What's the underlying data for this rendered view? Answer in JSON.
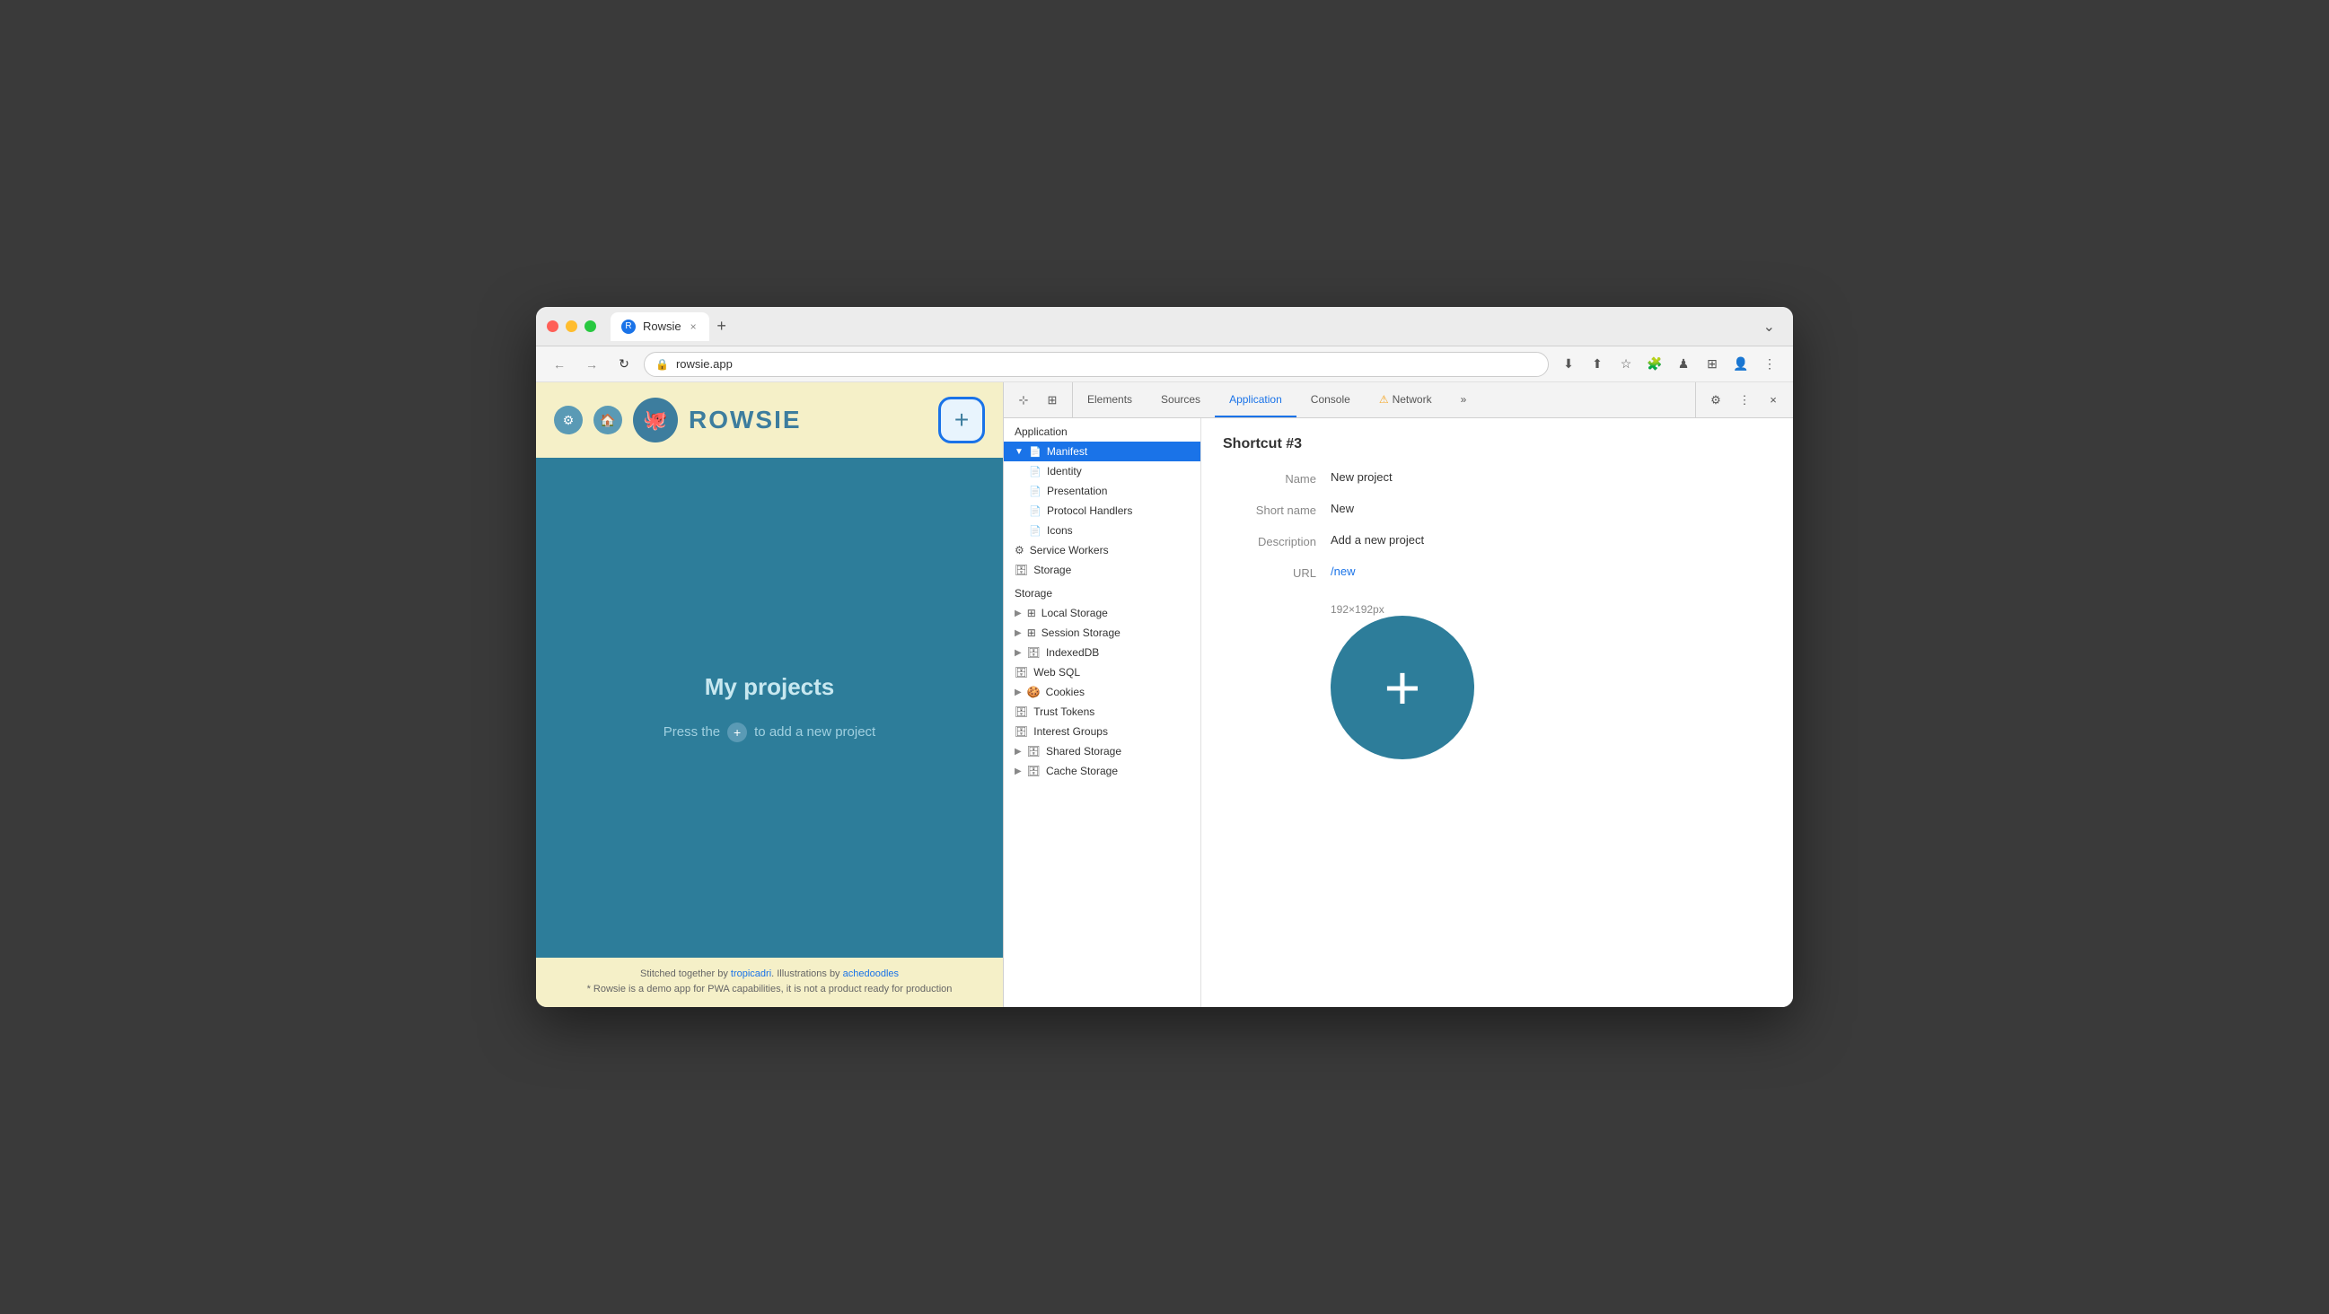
{
  "browser": {
    "tab_title": "Rowsie",
    "url": "rowsie.app",
    "tab_close_label": "×",
    "tab_add_label": "+",
    "chevron_label": "⌄"
  },
  "nav": {
    "back_label": "←",
    "forward_label": "→",
    "refresh_label": "↻",
    "lock_icon": "🔒",
    "url": "rowsie.app",
    "download_icon": "⬇",
    "share_icon": "⬆",
    "star_icon": "☆",
    "extension_icon": "🧩",
    "plugin_icon": "♟",
    "layout_icon": "⊞",
    "profile_icon": "👤",
    "menu_icon": "⋮"
  },
  "site": {
    "header_icons": [
      "⚙",
      "🏠"
    ],
    "logo_char": "🐙",
    "logo_text": "ROWSIE",
    "add_plus": "+",
    "main_title": "My projects",
    "subtitle_prefix": "Press the",
    "subtitle_suffix": "to add a new project",
    "footer_text1": "Stitched together by ",
    "footer_link1": "tropicadri",
    "footer_text2": ". Illustrations by ",
    "footer_link2": "achedoodles",
    "footer_note": "* Rowsie is a demo app for PWA capabilities, it is not a product ready for production"
  },
  "devtools": {
    "tabs": [
      {
        "label": "Elements",
        "active": false
      },
      {
        "label": "Sources",
        "active": false
      },
      {
        "label": "Application",
        "active": true
      },
      {
        "label": "Console",
        "active": false
      },
      {
        "label": "Network",
        "active": false,
        "warning": true
      }
    ],
    "more_tabs_label": "»",
    "settings_icon": "⚙",
    "dots_icon": "⋮",
    "close_icon": "×",
    "cursor_icon": "⊹",
    "layout_icon": "⊞"
  },
  "sidebar": {
    "app_section": "Application",
    "manifest_item": "Manifest",
    "manifest_children": [
      {
        "label": "Identity"
      },
      {
        "label": "Presentation"
      },
      {
        "label": "Protocol Handlers"
      },
      {
        "label": "Icons"
      }
    ],
    "service_workers_item": "Service Workers",
    "storage_item": "Storage",
    "storage_section": "Storage",
    "storage_items": [
      {
        "label": "Local Storage",
        "has_arrow": true
      },
      {
        "label": "Session Storage",
        "has_arrow": true
      },
      {
        "label": "IndexedDB",
        "has_arrow": true
      },
      {
        "label": "Web SQL",
        "has_arrow": false
      },
      {
        "label": "Cookies",
        "has_arrow": true
      },
      {
        "label": "Trust Tokens",
        "has_arrow": false
      },
      {
        "label": "Interest Groups",
        "has_arrow": false
      },
      {
        "label": "Shared Storage",
        "has_arrow": true
      },
      {
        "label": "Cache Storage",
        "has_arrow": true
      }
    ]
  },
  "shortcut": {
    "title": "Shortcut #3",
    "fields": [
      {
        "label": "Name",
        "value": "New project",
        "type": "text"
      },
      {
        "label": "Short name",
        "value": "New",
        "type": "text"
      },
      {
        "label": "Description",
        "value": "Add a new project",
        "type": "text"
      },
      {
        "label": "URL",
        "value": "/new",
        "type": "link"
      }
    ],
    "icon_size": "192×192px",
    "plus_sign": "+"
  }
}
